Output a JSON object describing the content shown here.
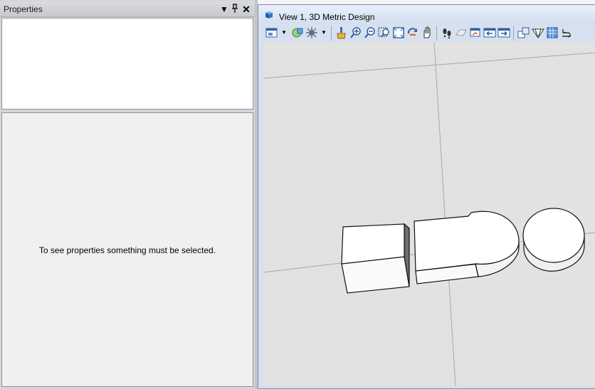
{
  "properties": {
    "title": "Properties",
    "empty_message": "To see properties something must be selected."
  },
  "view": {
    "title": "View 1, 3D Metric Design"
  },
  "icons": {
    "panel_menu": "dropdown-arrow-icon",
    "panel_pin": "pin-icon",
    "panel_close": "close-icon",
    "view_window": "view-cube-icon"
  },
  "toolbar": [
    "view-attributes-icon",
    "display-style-icon",
    "lighting-icon",
    "update-view-icon",
    "zoom-in-icon",
    "zoom-out-icon",
    "window-area-icon",
    "fit-view-icon",
    "rotate-view-icon",
    "pan-view-icon",
    "walk-icon",
    "view-previous-icon",
    "view-next-icon",
    "copy-view-icon",
    "standard-views-icon",
    "view-display-mode-icon",
    "camera-settings-icon",
    "clip-volume-icon"
  ]
}
